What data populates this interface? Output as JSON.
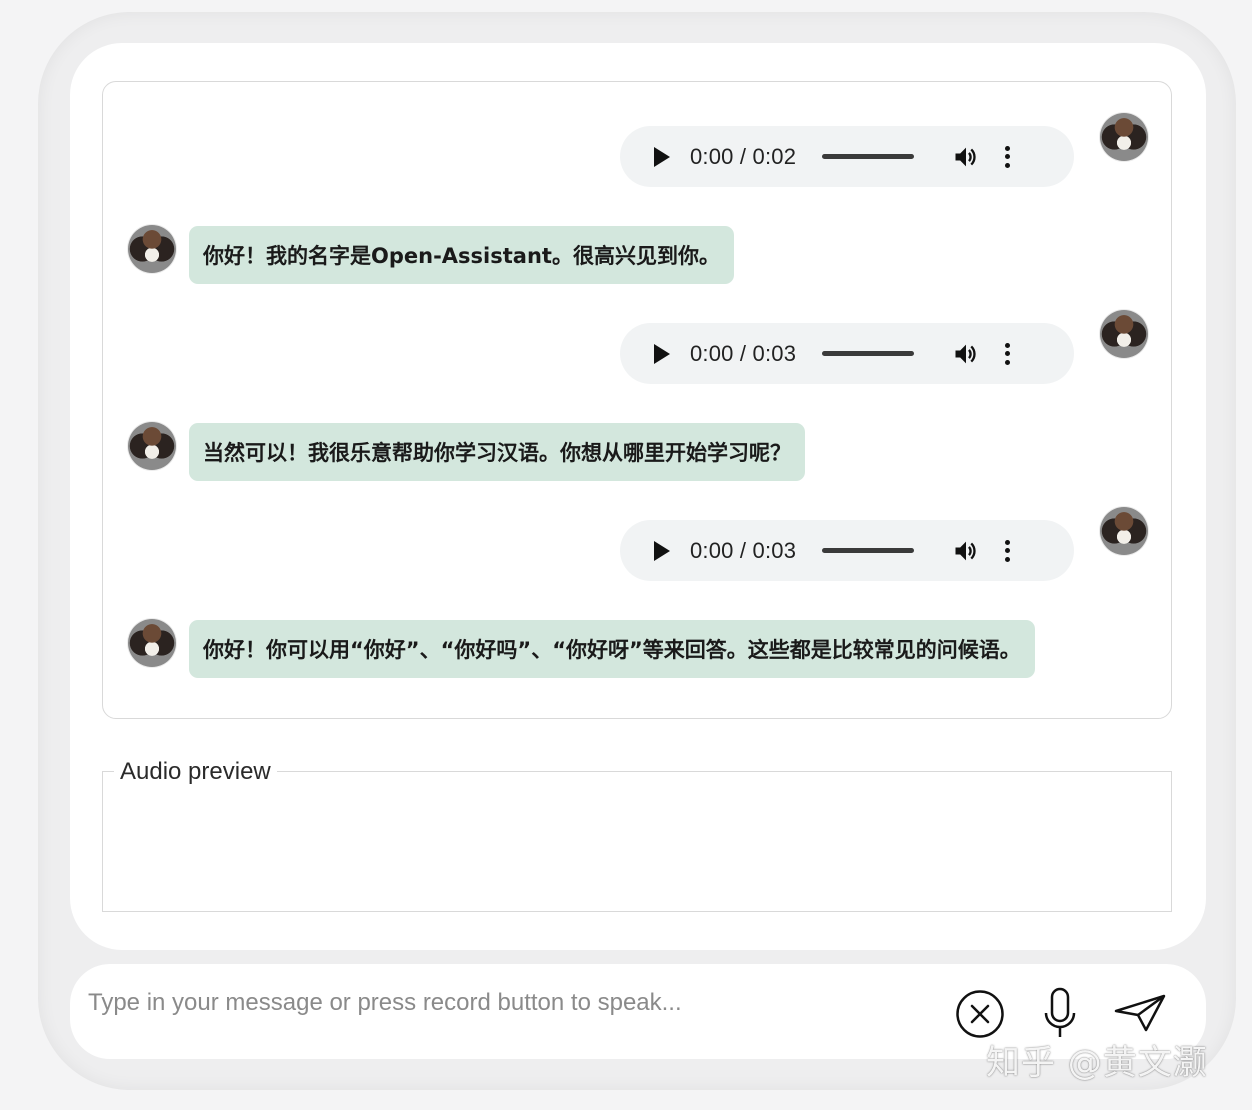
{
  "chat": {
    "audio_messages": [
      {
        "time": "0:00 / 0:02"
      },
      {
        "time": "0:00 / 0:03"
      },
      {
        "time": "0:00 / 0:03"
      }
    ],
    "bot_messages": [
      "你好！我的名字是Open-Assistant。很高兴见到你。",
      "当然可以！我很乐意帮助你学习汉语。你想从哪里开始学习呢？",
      "你好！你可以用“你好”、“你好吗”、“你好呀”等来回答。这些都是比较常见的问候语。"
    ],
    "user_avatar_icon": "dog-avatar-icon",
    "bot_avatar_icon": "dog-avatar-icon",
    "bot_bubble_color": "#d3e7dd"
  },
  "audio_preview": {
    "label": "Audio preview"
  },
  "input_bar": {
    "placeholder": "Type in your message or press record button to speak...",
    "value": "",
    "icons": [
      "clear-icon",
      "microphone-icon",
      "send-icon"
    ]
  },
  "watermark": {
    "text": "知乎 @黄文灏"
  }
}
